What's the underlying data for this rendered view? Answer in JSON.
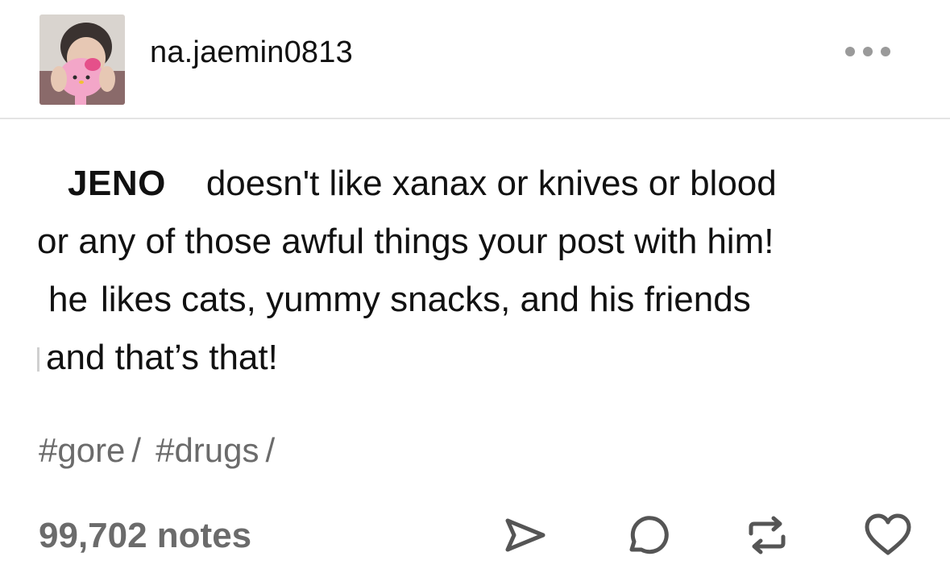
{
  "post": {
    "username": "na.jaemin0813",
    "body": {
      "line1_name": "JENO",
      "line1_rest": "doesn't like xanax or knives or blood",
      "line2_a": "or any of those awful things your post with",
      "line2_b": "him!",
      "line3_a": "he",
      "line3_b": "likes",
      "line3_c": "cats, yummy snacks, and his friends",
      "line4": "and that’s that!"
    },
    "tags": [
      {
        "label": "#gore",
        "sep": "/"
      },
      {
        "label": "#drugs",
        "sep": "/"
      }
    ],
    "notes": "99,702 notes",
    "icons": {
      "avatar": "avatar",
      "more": "more-dots-icon",
      "share": "share-send-icon",
      "reply": "reply-bubble-icon",
      "reblog": "reblog-icon",
      "like": "heart-icon"
    },
    "colors": {
      "text": "#111111",
      "muted": "#6b6b6b",
      "divider": "#e4e4e4",
      "avatar_pink": "#f3a6c8"
    }
  }
}
